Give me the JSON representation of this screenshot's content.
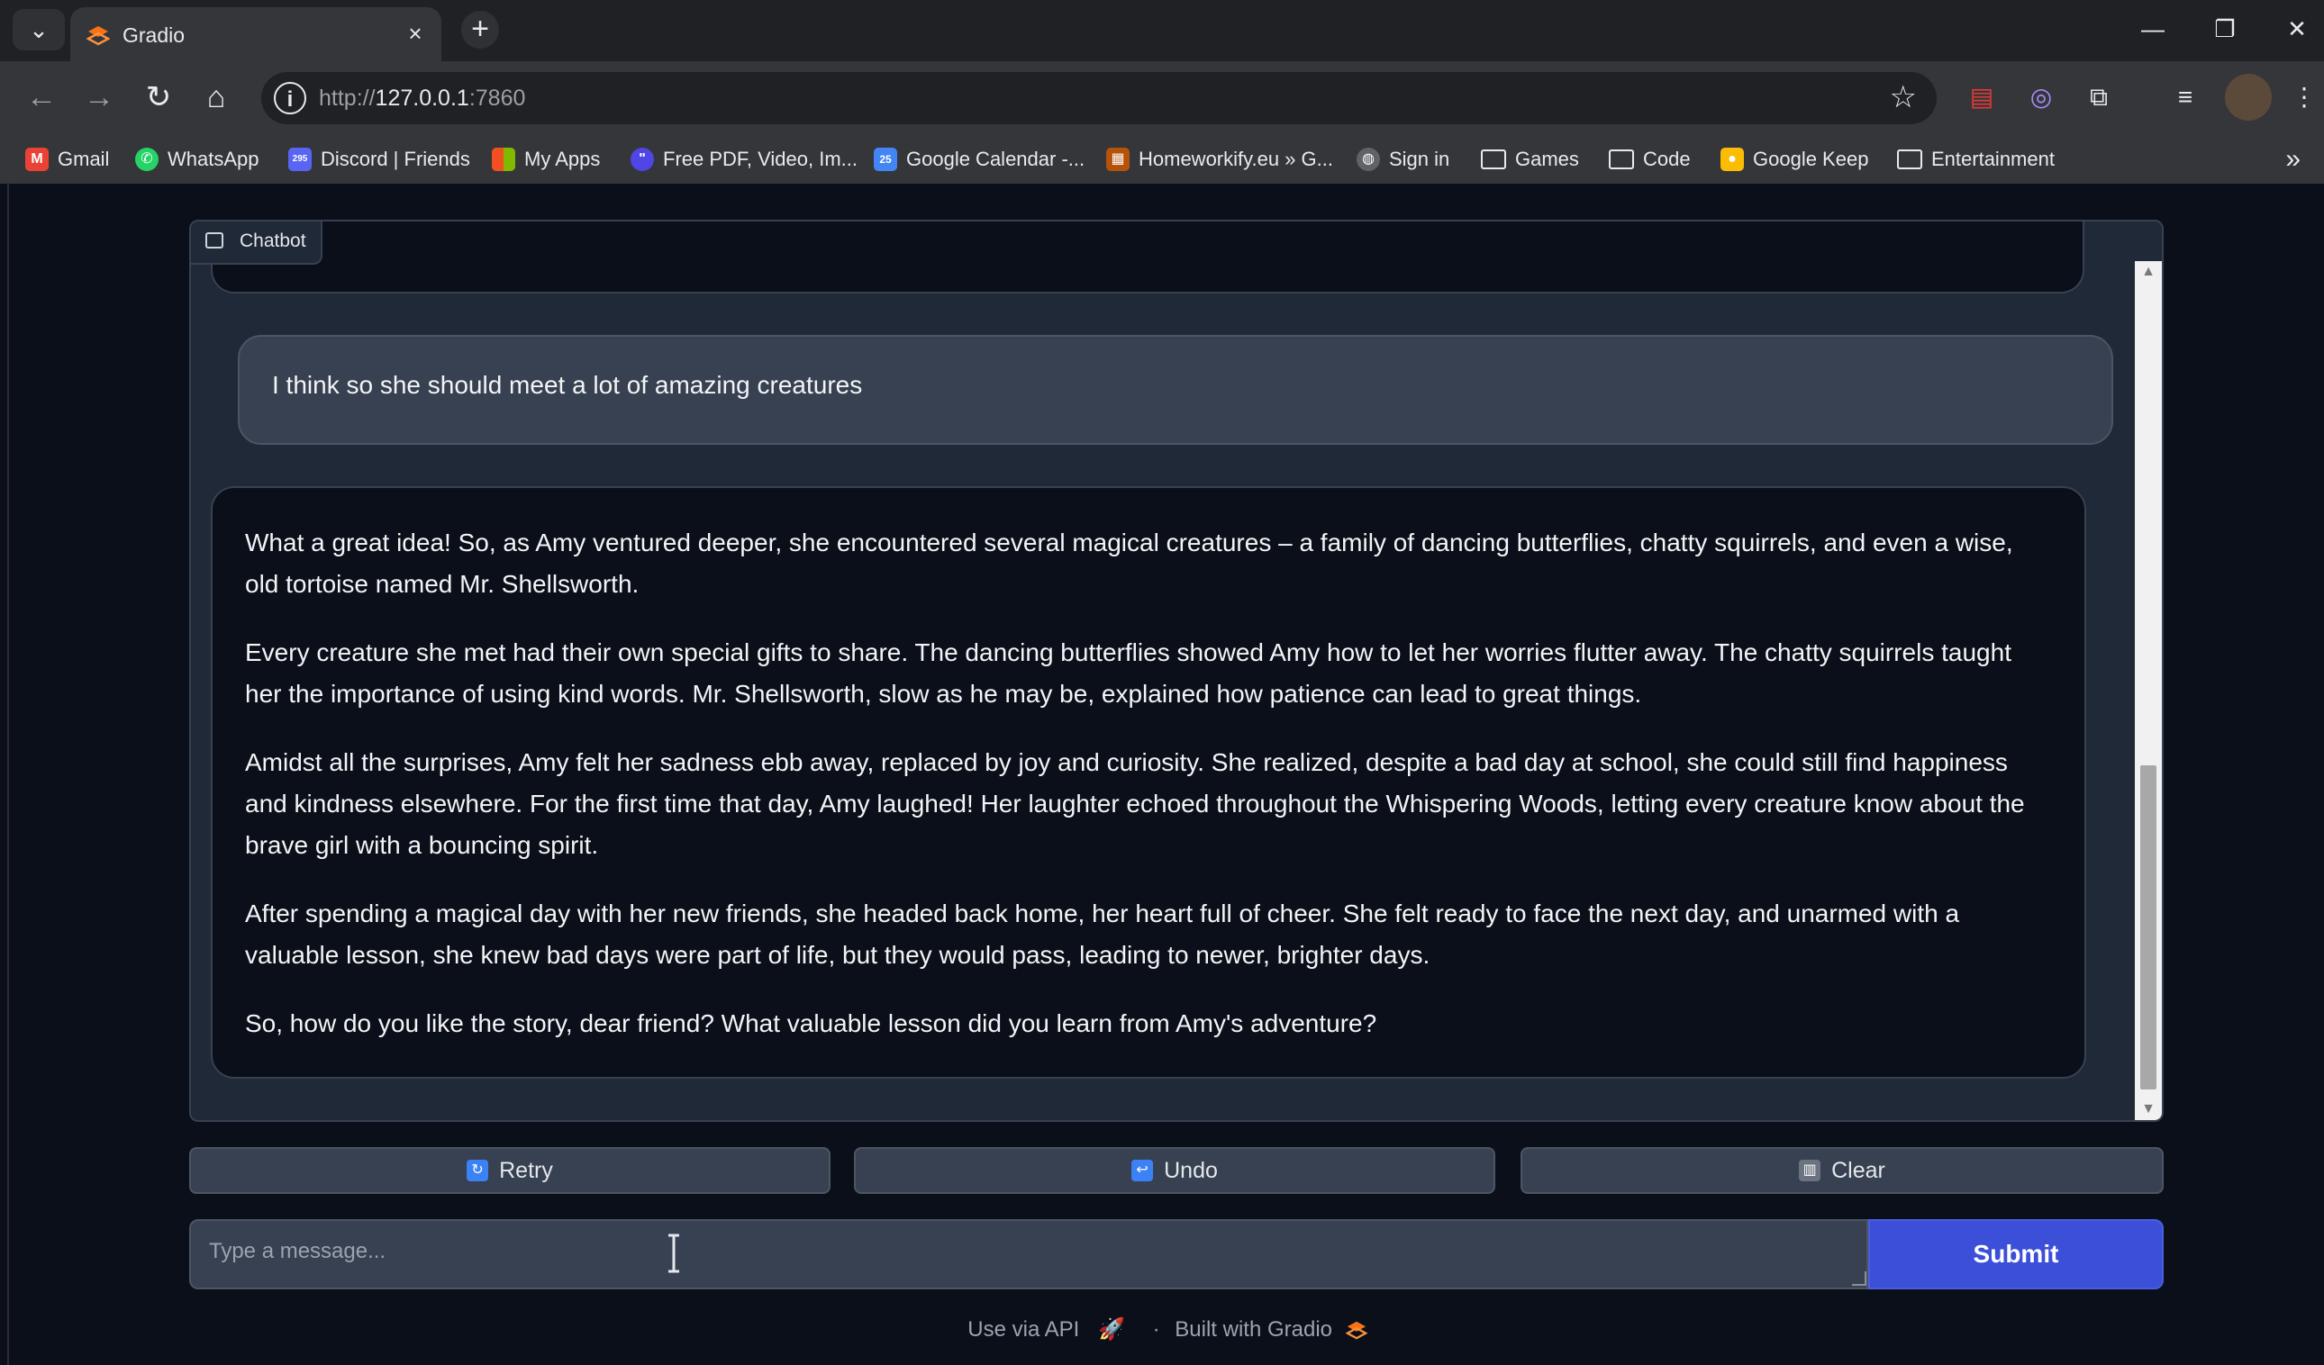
{
  "browser": {
    "tab_title": "Gradio",
    "url_prefix": "http://",
    "url_host": "127.0.0.1",
    "url_rest": ":7860",
    "bookmarks": [
      {
        "label": "Gmail",
        "icon": "gmail-icon"
      },
      {
        "label": "WhatsApp",
        "icon": "whatsapp-icon"
      },
      {
        "label": "Discord | Friends",
        "icon": "discord-icon",
        "badge": "295"
      },
      {
        "label": "My Apps",
        "icon": "microsoft-icon"
      },
      {
        "label": "Free PDF, Video, Im...",
        "icon": "toolbox-icon"
      },
      {
        "label": "Google Calendar -...",
        "icon": "calendar-icon",
        "badge": "25"
      },
      {
        "label": "Homeworkify.eu » G...",
        "icon": "books-icon"
      },
      {
        "label": "Sign in",
        "icon": "globe-icon"
      },
      {
        "label": "Games",
        "icon": "folder-icon"
      },
      {
        "label": "Code",
        "icon": "folder-icon"
      },
      {
        "label": "Google Keep",
        "icon": "keep-icon"
      },
      {
        "label": "Entertainment",
        "icon": "folder-icon"
      }
    ]
  },
  "chatbot": {
    "label": "Chatbot",
    "user_message": "I think so she should meet a lot of amazing creatures",
    "bot_paragraphs": [
      "What a great idea! So, as Amy ventured deeper, she encountered several magical creatures – a family of dancing butterflies, chatty squirrels, and even a wise, old tortoise named Mr. Shellsworth.",
      "Every creature she met had their own special gifts to share. The dancing butterflies showed Amy how to let her worries flutter away. The chatty squirrels taught her the importance of using kind words. Mr. Shellsworth, slow as he may be, explained how patience can lead to great things.",
      "Amidst all the surprises, Amy felt her sadness ebb away, replaced by joy and curiosity. She realized, despite a bad day at school, she could still find happiness and kindness elsewhere. For the first time that day, Amy laughed! Her laughter echoed throughout the Whispering Woods, letting every creature know about the brave girl with a bouncing spirit.",
      "After spending a magical day with her new friends, she headed back home, her heart full of cheer. She felt ready to face the next day, and unarmed with a valuable lesson, she knew bad days were part of life, but they would pass, leading to newer, brighter days.",
      "So, how do you like the story, dear friend? What valuable lesson did you learn from Amy's adventure?"
    ]
  },
  "actions": {
    "retry": "Retry",
    "undo": "Undo",
    "clear": "Clear"
  },
  "input": {
    "placeholder": "Type a message...",
    "value": "",
    "submit": "Submit"
  },
  "footer": {
    "api": "Use via API",
    "separator": "·",
    "built": "Built with Gradio"
  },
  "colors": {
    "background": "#0b0f19",
    "panel": "#1f2937",
    "submit": "#3b4fd8"
  }
}
